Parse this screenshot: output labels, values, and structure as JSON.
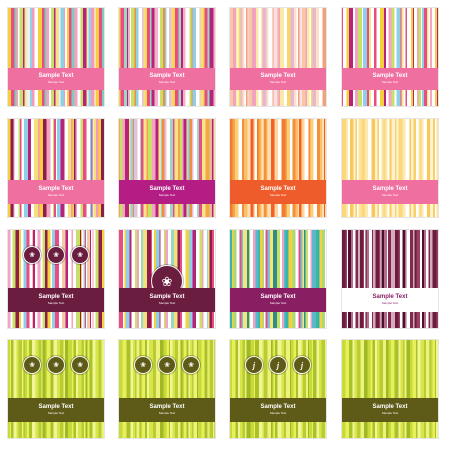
{
  "tiles": [
    {
      "palette": [
        "#f6cf3c",
        "#e84c83",
        "#7fcdb8",
        "#f4a2c2",
        "#ffffff",
        "#c8e06a",
        "#b5237a",
        "#f7e38d",
        "#f0f0f0",
        "#8fd0e8",
        "#f29ab7",
        "#ffffff"
      ],
      "band": {
        "color": "#ef6fa0",
        "title": "Sample Text",
        "subtitle": "Sample Text"
      },
      "badges": []
    },
    {
      "palette": [
        "#f8d54d",
        "#e84c83",
        "#9cd6c5",
        "#b5237a",
        "#f6b0c9",
        "#ffffff",
        "#c8e06a",
        "#f18d3d",
        "#8fd0e8",
        "#ffffff",
        "#e6c2d8",
        "#f2e07a"
      ],
      "band": {
        "color": "#ef6fa0",
        "title": "Sample Text",
        "subtitle": "Sample Text"
      },
      "badges": []
    },
    {
      "palette": [
        "#f7c7a6",
        "#f4a2c2",
        "#fbe9a8",
        "#ffffff",
        "#f6d76a",
        "#e9b6d1",
        "#fde2c8",
        "#ffffff",
        "#f0a27d",
        "#f8dfe9"
      ],
      "band": {
        "color": "#ef6fa0",
        "title": "Sample Text",
        "subtitle": "Sample Text"
      },
      "badges": []
    },
    {
      "palette": [
        "#e84c83",
        "#ffffff",
        "#f6cf3c",
        "#b5237a",
        "#ffffff",
        "#f4a2c2",
        "#c8e06a",
        "#ffffff",
        "#8fd0e8",
        "#e84c83",
        "#fbe48a",
        "#ffffff"
      ],
      "band": {
        "color": "#ef6fa0",
        "title": "Sample Text",
        "subtitle": "Sample Text"
      },
      "badges": []
    },
    {
      "palette": [
        "#f6cf3c",
        "#8c1e4d",
        "#f4a2c2",
        "#ffffff",
        "#c8e06a",
        "#e84c83",
        "#ffffff",
        "#8fd0e8",
        "#b5237a",
        "#ffffff",
        "#f2e07a",
        "#f29ab7"
      ],
      "band": {
        "color": "#ef6fa0",
        "title": "Sample Text",
        "subtitle": "Sample Text"
      },
      "badges": []
    },
    {
      "palette": [
        "#f6a545",
        "#c8e06a",
        "#f4a2c2",
        "#b5237a",
        "#fbe48a",
        "#8fd0e8",
        "#f18d3d",
        "#e6c2d8",
        "#ffffff",
        "#9cd6c5",
        "#e84c83",
        "#f7e38d"
      ],
      "band": {
        "color": "#b41e84",
        "title": "Sample Text",
        "subtitle": "Sample Text"
      },
      "badges": []
    },
    {
      "palette": [
        "#f27a32",
        "#f6a545",
        "#fbd07a",
        "#ffffff",
        "#f48f3a",
        "#fbbf6a",
        "#ffe2b0",
        "#f25f2a",
        "#ffd59a",
        "#ffffff"
      ],
      "band": {
        "color": "#ef5c2c",
        "title": "Sample Text",
        "subtitle": "Sample Text"
      },
      "badges": []
    },
    {
      "palette": [
        "#fbd87a",
        "#fde9b0",
        "#ffffff",
        "#f8c85a",
        "#fff2cc",
        "#f6d06a",
        "#ffffff",
        "#fbe3a0"
      ],
      "band": {
        "color": "#ef6fa0",
        "title": "Sample Text",
        "subtitle": "Sample Text"
      },
      "badges": []
    },
    {
      "palette": [
        "#f4a2c2",
        "#ffffff",
        "#c8e06a",
        "#8c1e4d",
        "#f6cf3c",
        "#ffffff",
        "#8fd0e8",
        "#e84c83",
        "#ffffff",
        "#f7c7a6",
        "#b5237a",
        "#ffffff"
      ],
      "band": {
        "color": "#6b1d3f",
        "title": "Sample Text",
        "subtitle": "Sample Text"
      },
      "badges": [
        {
          "glyph": "❀"
        },
        {
          "glyph": "❀"
        },
        {
          "glyph": "❀"
        }
      ],
      "badge_color": "#6b1d3f"
    },
    {
      "palette": [
        "#e84c83",
        "#ffffff",
        "#f6cf3c",
        "#8fd0e8",
        "#b5237a",
        "#ffffff",
        "#c8e06a",
        "#f4a2c2",
        "#ffffff",
        "#9cd6c5",
        "#f2e07a",
        "#8c1e4d"
      ],
      "band": {
        "color": "#6b1d3f",
        "title": "Sample Text",
        "subtitle": "Sample Text"
      },
      "badges": [
        {
          "glyph": "❀"
        }
      ],
      "badge_color": "#6b1d3f",
      "badge_big": true
    },
    {
      "palette": [
        "#36b6a8",
        "#f6cf3c",
        "#a7d97c",
        "#ffffff",
        "#e84c83",
        "#6fc7d6",
        "#f9e37a",
        "#2f8f86",
        "#c8e06a",
        "#ffffff",
        "#f4a2c2",
        "#58b9c9"
      ],
      "band": {
        "color": "#8a1e63",
        "title": "Sample Text",
        "subtitle": "Sample Text"
      },
      "badges": []
    },
    {
      "palette": [
        "#6b1d3f",
        "#9a3e63",
        "#ffffff",
        "#4d0f2c",
        "#b86b8a",
        "#ffffff",
        "#7d2a4d",
        "#d8a9bd"
      ],
      "band": {
        "color": "#ffffff",
        "title": "Sample Text",
        "subtitle": "Sample Text",
        "dark_text": true
      },
      "badges": []
    },
    {
      "palette": [
        "#c8d93a",
        "#e7ef5a",
        "#a9c22a",
        "#f2f594",
        "#d7e54a",
        "#b8cd34",
        "#eef27a",
        "#9fb825"
      ],
      "band": {
        "color": "#5e5a18",
        "title": "Sample Text",
        "subtitle": "Sample Text"
      },
      "badges": [
        {
          "glyph": "❀"
        },
        {
          "glyph": "❀"
        },
        {
          "glyph": "❀"
        }
      ],
      "badge_color": "#5e5a18"
    },
    {
      "palette": [
        "#c8d93a",
        "#e7ef5a",
        "#a9c22a",
        "#f2f594",
        "#d7e54a",
        "#b8cd34",
        "#eef27a",
        "#9fb825"
      ],
      "band": {
        "color": "#5e5a18",
        "title": "Sample Text",
        "subtitle": "Sample Text"
      },
      "badges": [
        {
          "glyph": "❀"
        },
        {
          "glyph": "❀"
        },
        {
          "glyph": "❀"
        }
      ],
      "badge_color": "#5e5a18"
    },
    {
      "palette": [
        "#c8d93a",
        "#e7ef5a",
        "#a9c22a",
        "#f2f594",
        "#d7e54a",
        "#b8cd34",
        "#eef27a",
        "#9fb825"
      ],
      "band": {
        "color": "#5e5a18",
        "title": "Sample Text",
        "subtitle": "Sample Text"
      },
      "badges": [
        {
          "glyph": "j",
          "letter": true
        },
        {
          "glyph": "j",
          "letter": true
        },
        {
          "glyph": "j",
          "letter": true
        }
      ],
      "badge_color": "#5e5a18"
    },
    {
      "palette": [
        "#c8d93a",
        "#e7ef5a",
        "#a9c22a",
        "#f2f594",
        "#d7e54a",
        "#b8cd34",
        "#eef27a",
        "#9fb825"
      ],
      "band": {
        "color": "#5e5a18",
        "title": "Sample Text",
        "subtitle": "Sample Text"
      },
      "badges": []
    }
  ]
}
